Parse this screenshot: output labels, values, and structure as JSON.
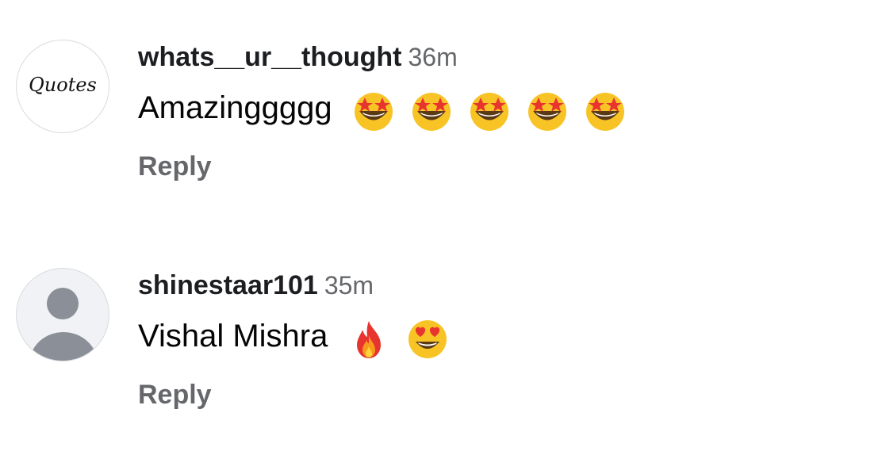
{
  "comments": [
    {
      "avatar": {
        "type": "logo",
        "text": "Quotes"
      },
      "username": "whats__ur__thought",
      "time": "36m",
      "text": "Amazinggggg",
      "emojis": [
        "star-struck-icon",
        "star-struck-icon",
        "star-struck-icon",
        "star-struck-icon",
        "star-struck-icon"
      ],
      "reply_label": "Reply"
    },
    {
      "avatar": {
        "type": "default"
      },
      "username": "shinestaar101",
      "time": "35m",
      "text": "Vishal Mishra",
      "emojis": [
        "fire-icon",
        "heart-eyes-icon"
      ],
      "reply_label": "Reply"
    }
  ],
  "colors": {
    "username": "#1c1e21",
    "muted": "#65676b",
    "avatar_placeholder": "#8a8f98",
    "avatar_bg": "#f0f2f5",
    "emoji_yellow": "#f7c325",
    "emoji_red": "#e8342f"
  }
}
